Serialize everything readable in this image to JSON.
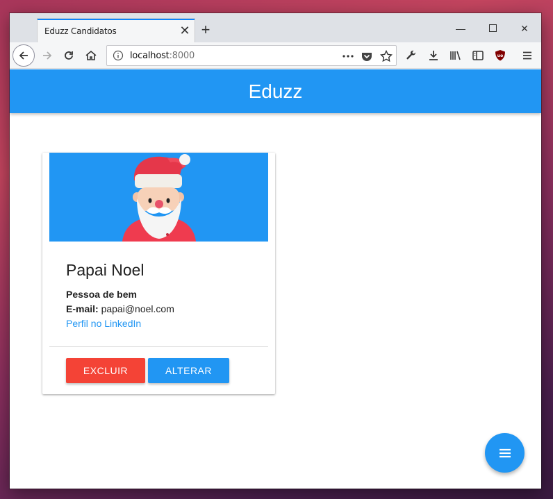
{
  "browser": {
    "tab_title": "Eduzz Candidatos",
    "url_host": "localhost",
    "url_port": ":8000",
    "icons": {
      "back": "back-arrow-icon",
      "forward": "forward-arrow-icon",
      "reload": "reload-icon",
      "home": "home-icon",
      "info": "info-icon",
      "more": "more-dots-icon",
      "pocket": "pocket-icon",
      "bookmark": "star-icon",
      "tools": "wrench-icon",
      "download": "download-icon",
      "library": "library-icon",
      "sidebar": "sidebar-icon",
      "ublock": "ublock-icon",
      "menu": "hamburger-icon"
    }
  },
  "app": {
    "title": "Eduzz",
    "accent_color": "#2196f3",
    "danger_color": "#f44336"
  },
  "candidate_card": {
    "name": "Papai Noel",
    "subtitle": "Pessoa de bem",
    "email_label": "E-mail:",
    "email": "papai@noel.com",
    "linkedin_link": "Perfil no LinkedIn",
    "delete_label": "EXCLUIR",
    "edit_label": "ALTERAR",
    "image": "santa-claus-avatar"
  },
  "fab": {
    "icon": "menu-icon"
  }
}
